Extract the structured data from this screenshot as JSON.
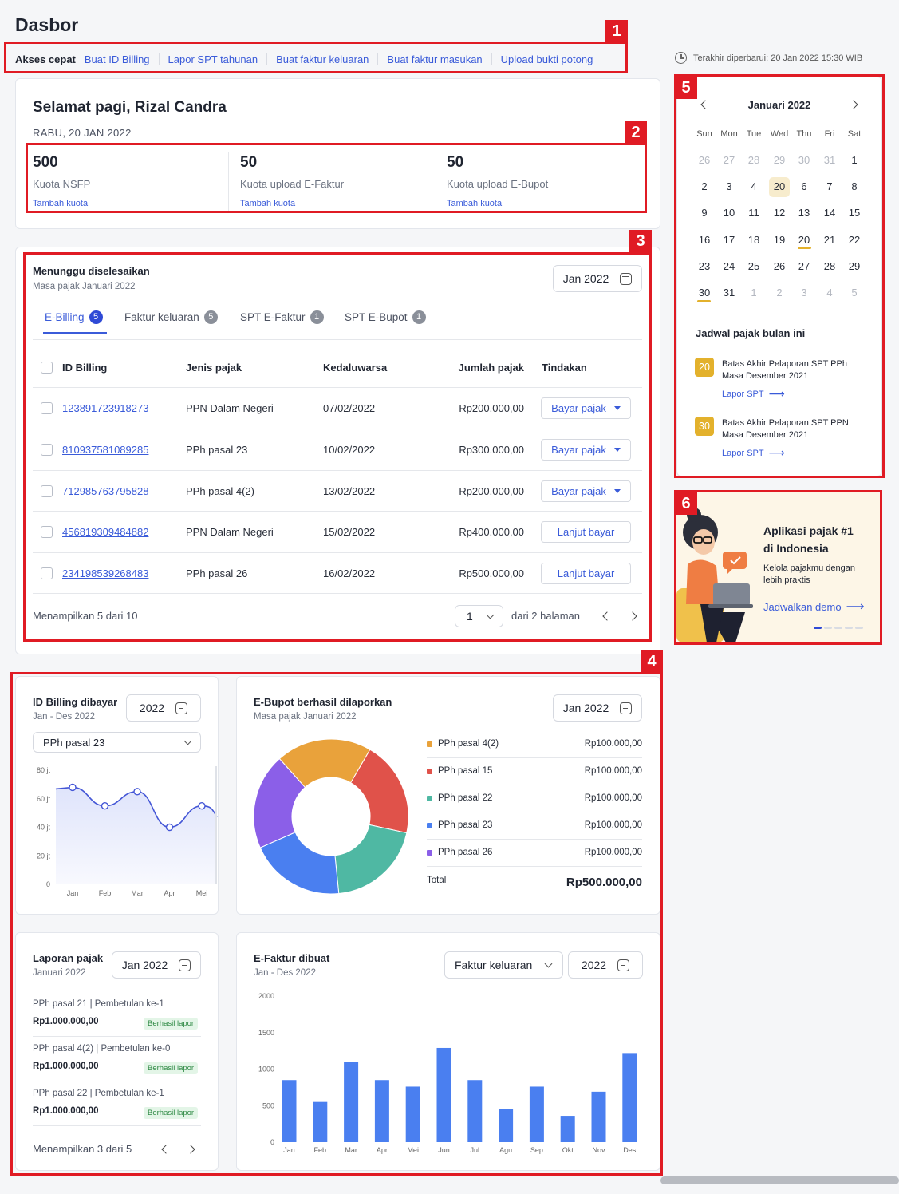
{
  "page": {
    "title": "Dasbor"
  },
  "quick_access": {
    "label": "Akses cepat",
    "links": [
      "Buat ID Billing",
      "Lapor SPT tahunan",
      "Buat faktur keluaran",
      "Buat faktur masukan",
      "Upload bukti potong"
    ]
  },
  "last_updated": "Terakhir diperbarui: 20 Jan 2022 15:30 WIB",
  "greeting": {
    "title": "Selamat pagi, Rizal Candra",
    "date": "RABU, 20 JAN 2022",
    "quotas": [
      {
        "value": "500",
        "label": "Kuota NSFP",
        "action": "Tambah kuota"
      },
      {
        "value": "50",
        "label": "Kuota upload E-Faktur",
        "action": "Tambah kuota"
      },
      {
        "value": "50",
        "label": "Kuota upload E-Bupot",
        "action": "Tambah kuota"
      }
    ]
  },
  "pending": {
    "title": "Menunggu diselesaikan",
    "subtitle": "Masa pajak Januari 2022",
    "period": "Jan 2022",
    "tabs": [
      {
        "label": "E-Billing",
        "count": "5"
      },
      {
        "label": "Faktur keluaran",
        "count": "5"
      },
      {
        "label": "SPT E-Faktur",
        "count": "1"
      },
      {
        "label": "SPT E-Bupot",
        "count": "1"
      }
    ],
    "columns": [
      "ID Billing",
      "Jenis pajak",
      "Kedaluwarsa",
      "Jumlah pajak",
      "Tindakan"
    ],
    "rows": [
      {
        "id": "123891723918273",
        "type": "PPN Dalam Negeri",
        "expiry": "07/02/2022",
        "amount": "Rp200.000,00",
        "action": "Bayar pajak"
      },
      {
        "id": "810937581089285",
        "type": "PPh pasal 23",
        "expiry": "10/02/2022",
        "amount": "Rp300.000,00",
        "action": "Bayar pajak"
      },
      {
        "id": "712985763795828",
        "type": "PPh pasal 4(2)",
        "expiry": "13/02/2022",
        "amount": "Rp200.000,00",
        "action": "Bayar pajak"
      },
      {
        "id": "456819309484882",
        "type": "PPN Dalam Negeri",
        "expiry": "15/02/2022",
        "amount": "Rp400.000,00",
        "action": "Lanjut bayar"
      },
      {
        "id": "234198539268483",
        "type": "PPh pasal 26",
        "expiry": "16/02/2022",
        "amount": "Rp500.000,00",
        "action": "Lanjut bayar"
      }
    ],
    "footer": "Menampilkan 5 dari 10",
    "page_select": "1",
    "page_of": "dari 2 halaman"
  },
  "billing_paid": {
    "title": "ID Billing dibayar",
    "subtitle": "Jan - Des 2022",
    "year": "2022",
    "filter": "PPh pasal 23"
  },
  "ebupot": {
    "title": "E-Bupot berhasil dilaporkan",
    "subtitle": "Masa pajak Januari 2022",
    "period": "Jan 2022",
    "total_label": "Total",
    "total_value": "Rp500.000,00"
  },
  "reports": {
    "title": "Laporan pajak",
    "subtitle": "Januari 2022",
    "period": "Jan 2022",
    "items": [
      {
        "name": "PPh pasal 21 | Pembetulan ke-1",
        "amount": "Rp1.000.000,00",
        "status": "Berhasil lapor"
      },
      {
        "name": "PPh pasal 4(2) | Pembetulan ke-0",
        "amount": "Rp1.000.000,00",
        "status": "Berhasil lapor"
      },
      {
        "name": "PPh pasal 22 | Pembetulan ke-1",
        "amount": "Rp1.000.000,00",
        "status": "Berhasil lapor"
      }
    ],
    "footer": "Menampilkan 3 dari 5"
  },
  "efaktur": {
    "title": "E-Faktur dibuat",
    "subtitle": "Jan - Des 2022",
    "filter": "Faktur keluaran",
    "year": "2022"
  },
  "calendar": {
    "month": "Januari 2022",
    "dow": [
      "Sun",
      "Mon",
      "Tue",
      "Wed",
      "Thu",
      "Fri",
      "Sat"
    ],
    "weeks": [
      [
        "26",
        "27",
        "28",
        "29",
        "30",
        "31",
        "1"
      ],
      [
        "2",
        "3",
        "4",
        "20",
        "6",
        "7",
        "8"
      ],
      [
        "9",
        "10",
        "11",
        "12",
        "13",
        "14",
        "15"
      ],
      [
        "16",
        "17",
        "18",
        "19",
        "20",
        "21",
        "22"
      ],
      [
        "23",
        "24",
        "25",
        "26",
        "27",
        "28",
        "29"
      ],
      [
        "30",
        "31",
        "1",
        "2",
        "3",
        "4",
        "5"
      ]
    ],
    "schedule_title": "Jadwal pajak bulan ini",
    "events": [
      {
        "day": "20",
        "text1": "Batas Akhir Pelaporan SPT PPh",
        "text2": "Masa Desember 2021",
        "action": "Lapor SPT"
      },
      {
        "day": "30",
        "text1": "Batas Akhir Pelaporan SPT PPN",
        "text2": "Masa Desember 2021",
        "action": "Lapor SPT"
      }
    ]
  },
  "promo": {
    "title1": "Aplikasi pajak #1",
    "title2": "di Indonesia",
    "text1": "Kelola pajakmu dengan",
    "text2": "lebih praktis",
    "cta": "Jadwalkan demo"
  },
  "markers": [
    "1",
    "2",
    "3",
    "4",
    "5",
    "6"
  ],
  "colors": {
    "accent": "#3a5bd9",
    "highlight": "#e01b24",
    "bar": "#4a7ff0",
    "calendar_highlight": "#f7eccd",
    "event_badge": "#e3b12c"
  },
  "chart_data": [
    {
      "type": "line",
      "name": "ID Billing dibayar",
      "categories": [
        "Jan",
        "Feb",
        "Mar",
        "Apr",
        "Mei"
      ],
      "y_ticks": [
        "0",
        "20 jt",
        "40 jt",
        "60 jt",
        "80 jt"
      ],
      "values": [
        68,
        55,
        65,
        40,
        55
      ],
      "ylim": [
        0,
        80
      ],
      "grid": false
    },
    {
      "type": "pie",
      "name": "E-Bupot berhasil dilaporkan",
      "labels": [
        "PPh pasal 4(2)",
        "PPh pasal 15",
        "PPh pasal 22",
        "PPh pasal 23",
        "PPh pasal 26"
      ],
      "values": [
        100000,
        100000,
        100000,
        100000,
        100000
      ],
      "value_labels": [
        "Rp100.000,00",
        "Rp100.000,00",
        "Rp100.000,00",
        "Rp100.000,00",
        "Rp100.000,00"
      ],
      "colors": [
        "#e9a23b",
        "#e0524a",
        "#4fb8a3",
        "#4a7ff0",
        "#8b5fe8"
      ],
      "legend": "right"
    },
    {
      "type": "bar",
      "name": "E-Faktur dibuat",
      "categories": [
        "Jan",
        "Feb",
        "Mar",
        "Apr",
        "Mei",
        "Jun",
        "Jul",
        "Agu",
        "Sep",
        "Okt",
        "Nov",
        "Des"
      ],
      "values": [
        850,
        550,
        1100,
        850,
        760,
        1290,
        850,
        450,
        760,
        360,
        690,
        1220
      ],
      "y_ticks": [
        "0",
        "500",
        "1000",
        "1500",
        "2000"
      ],
      "ylim": [
        0,
        2000
      ],
      "grid": false
    }
  ]
}
